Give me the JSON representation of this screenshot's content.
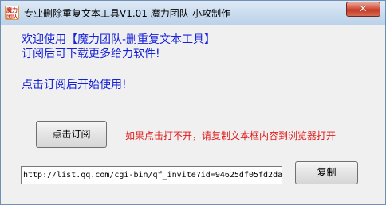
{
  "window": {
    "title": "专业删除重复文本工具V1.01 魔力团队-小攻制作",
    "icon_text": "魔力\n团队",
    "close_label": "✕"
  },
  "content": {
    "welcome_line1": "欢迎使用【魔力团队-删重复文本工具】",
    "welcome_line2": "订阅后可下载更多给力软件!",
    "prompt": "点击订阅后开始使用!",
    "subscribe_button": "点击订阅",
    "hint": "如果点击打不开，请复制文本框内容到浏览器打开",
    "url_value": "http://list.qq.com/cgi-bin/qf_invite?id=94625df05fd2da",
    "copy_button": "复制"
  },
  "colors": {
    "accent_text": "#1521d8",
    "warning_text": "#e21a1a"
  }
}
